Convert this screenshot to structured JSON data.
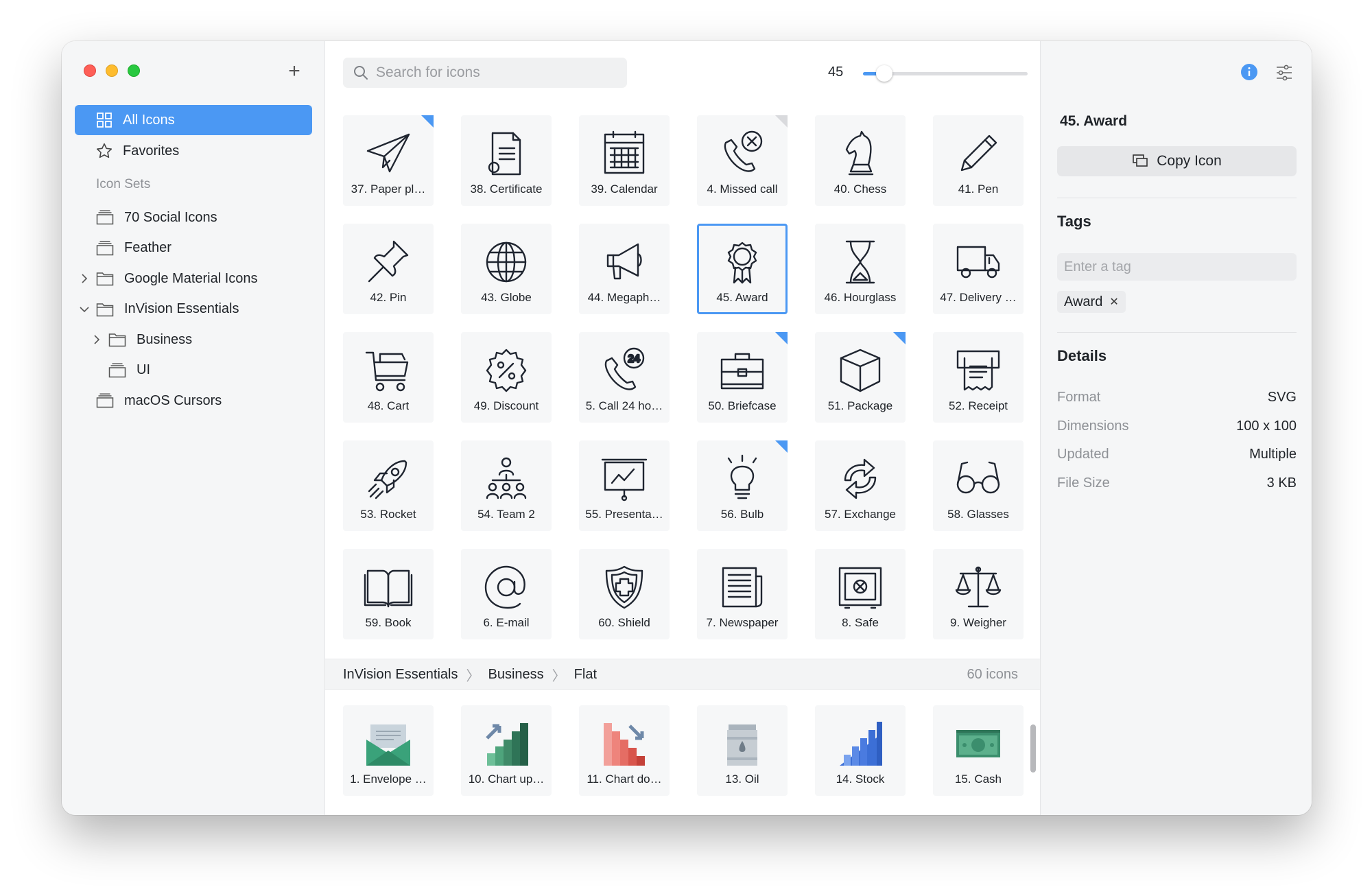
{
  "sidebar": {
    "add_label": "+",
    "nav": [
      {
        "label": "All Icons",
        "icon": "grid-icon",
        "active": true
      },
      {
        "label": "Favorites",
        "icon": "star-icon",
        "active": false
      }
    ],
    "section_label": "Icon Sets",
    "sets": [
      {
        "label": "70 Social Icons",
        "icon": "stack-icon",
        "indent": 0,
        "chevron": ""
      },
      {
        "label": "Feather",
        "icon": "stack-icon",
        "indent": 0,
        "chevron": ""
      },
      {
        "label": "Google Material Icons",
        "icon": "folder-icon",
        "indent": 0,
        "chevron": "right"
      },
      {
        "label": "InVision Essentials",
        "icon": "folder-icon",
        "indent": 0,
        "chevron": "down"
      },
      {
        "label": "Business",
        "icon": "folder-icon",
        "indent": 1,
        "chevron": "right"
      },
      {
        "label": "UI",
        "icon": "stack-icon",
        "indent": 1,
        "chevron": ""
      },
      {
        "label": "macOS Cursors",
        "icon": "stack-icon",
        "indent": 0,
        "chevron": ""
      }
    ]
  },
  "toolbar": {
    "search_placeholder": "Search for icons",
    "search_value": "",
    "size_value": "45",
    "size_fraction": 0.13
  },
  "icons": [
    {
      "label": "37. Paper pl…",
      "icon": "paper-plane-icon",
      "corner": "blue",
      "selected": false
    },
    {
      "label": "38. Certificate",
      "icon": "certificate-icon",
      "corner": "",
      "selected": false
    },
    {
      "label": "39. Calendar",
      "icon": "calendar-icon",
      "corner": "",
      "selected": false
    },
    {
      "label": "4. Missed call",
      "icon": "missed-call-icon",
      "corner": "grey",
      "selected": false
    },
    {
      "label": "40. Chess",
      "icon": "chess-icon",
      "corner": "",
      "selected": false
    },
    {
      "label": "41. Pen",
      "icon": "pen-icon",
      "corner": "",
      "selected": false
    },
    {
      "label": "42. Pin",
      "icon": "pin-icon",
      "corner": "",
      "selected": false
    },
    {
      "label": "43. Globe",
      "icon": "globe-icon",
      "corner": "",
      "selected": false
    },
    {
      "label": "44. Megaph…",
      "icon": "megaphone-icon",
      "corner": "",
      "selected": false
    },
    {
      "label": "45. Award",
      "icon": "award-icon",
      "corner": "",
      "selected": true
    },
    {
      "label": "46. Hourglass",
      "icon": "hourglass-icon",
      "corner": "",
      "selected": false
    },
    {
      "label": "47. Delivery …",
      "icon": "delivery-truck-icon",
      "corner": "",
      "selected": false
    },
    {
      "label": "48. Cart",
      "icon": "cart-icon",
      "corner": "",
      "selected": false
    },
    {
      "label": "49. Discount",
      "icon": "discount-icon",
      "corner": "",
      "selected": false
    },
    {
      "label": "5. Call 24 ho…",
      "icon": "call-24-icon",
      "corner": "",
      "selected": false
    },
    {
      "label": "50. Briefcase",
      "icon": "briefcase-icon",
      "corner": "blue",
      "selected": false
    },
    {
      "label": "51. Package",
      "icon": "package-icon",
      "corner": "blue",
      "selected": false
    },
    {
      "label": "52. Receipt",
      "icon": "receipt-icon",
      "corner": "",
      "selected": false
    },
    {
      "label": "53. Rocket",
      "icon": "rocket-icon",
      "corner": "",
      "selected": false
    },
    {
      "label": "54. Team 2",
      "icon": "team-icon",
      "corner": "",
      "selected": false
    },
    {
      "label": "55. Presenta…",
      "icon": "presentation-icon",
      "corner": "",
      "selected": false
    },
    {
      "label": "56. Bulb",
      "icon": "bulb-icon",
      "corner": "blue",
      "selected": false
    },
    {
      "label": "57. Exchange",
      "icon": "exchange-icon",
      "corner": "",
      "selected": false
    },
    {
      "label": "58. Glasses",
      "icon": "glasses-icon",
      "corner": "",
      "selected": false
    },
    {
      "label": "59. Book",
      "icon": "book-icon",
      "corner": "",
      "selected": false
    },
    {
      "label": "6. E-mail",
      "icon": "at-sign-icon",
      "corner": "",
      "selected": false
    },
    {
      "label": "60. Shield",
      "icon": "shield-icon",
      "corner": "",
      "selected": false
    },
    {
      "label": "7. Newspaper",
      "icon": "newspaper-icon",
      "corner": "",
      "selected": false
    },
    {
      "label": "8. Safe",
      "icon": "safe-icon",
      "corner": "",
      "selected": false
    },
    {
      "label": "9. Weigher",
      "icon": "scales-icon",
      "corner": "",
      "selected": false
    }
  ],
  "group": {
    "crumbs": [
      "InVision Essentials",
      "Business",
      "Flat"
    ],
    "count": "60 icons"
  },
  "flat_icons": [
    {
      "label": "1. Envelope …",
      "icon": "envelope-flat-icon"
    },
    {
      "label": "10. Chart up…",
      "icon": "chart-up-flat-icon"
    },
    {
      "label": "11. Chart do…",
      "icon": "chart-down-flat-icon"
    },
    {
      "label": "13. Oil",
      "icon": "oil-flat-icon"
    },
    {
      "label": "14. Stock",
      "icon": "stock-flat-icon"
    },
    {
      "label": "15. Cash",
      "icon": "cash-flat-icon"
    }
  ],
  "panel": {
    "title": "45. Award",
    "copy_label": "Copy Icon",
    "tags_heading": "Tags",
    "tag_placeholder": "Enter a tag",
    "tags": [
      "Award"
    ],
    "details_heading": "Details",
    "details": [
      {
        "key": "Format",
        "value": "SVG"
      },
      {
        "key": "Dimensions",
        "value": "100 x 100"
      },
      {
        "key": "Updated",
        "value": "Multiple"
      },
      {
        "key": "File Size",
        "value": "3 KB"
      }
    ]
  },
  "colors": {
    "accent": "#4b98f3",
    "sidebar_bg": "#f5f6f7",
    "tile_bg": "#f6f7f8"
  }
}
